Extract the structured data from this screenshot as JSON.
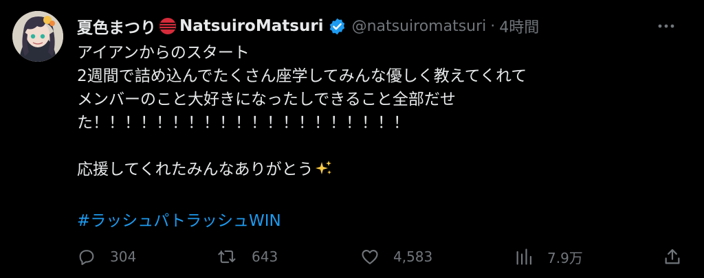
{
  "author": {
    "display_name": "夏色まつり",
    "display_name_en": "NatsuiroMatsuri",
    "handle": "@natsuiromatsuri",
    "separator": "·",
    "time": "4時間"
  },
  "tweet": {
    "lines": [
      "アイアンからのスタート",
      "2週間で詰め込んでたくさん座学してみんな優しく教えてくれて",
      "メンバーのこと大好きになったしできること全部だせ",
      "た！！！！！！！！！！！！！！！！！！！！",
      "",
      "応援してくれたみんなありがとう"
    ],
    "hashtag": "#ラッシュパトラッシュWIN"
  },
  "actions": {
    "replies": "304",
    "retweets": "643",
    "likes": "4,583",
    "views": "7.9万"
  },
  "icons": {
    "flag": "lantern-flag-icon",
    "verified": "verified-badge-icon",
    "more": "more-dots-icon",
    "sparkle": "sparkles-icon",
    "reply": "reply-icon",
    "retweet": "retweet-icon",
    "like": "heart-icon",
    "views": "views-chart-icon",
    "share": "share-icon"
  },
  "colors": {
    "background": "#000000",
    "text": "#e7e9ea",
    "muted": "#71767b",
    "link": "#1d9bf0",
    "verified": "#1d9bf0"
  }
}
